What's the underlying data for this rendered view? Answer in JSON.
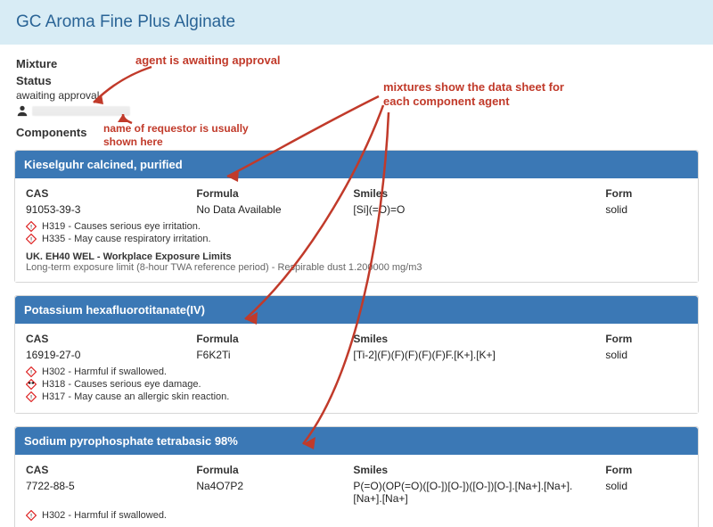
{
  "header": {
    "title": "GC Aroma Fine Plus Alginate"
  },
  "info": {
    "mixture_label": "Mixture",
    "status_label": "Status",
    "status_value": "awaiting approval"
  },
  "section": {
    "components_label": "Components"
  },
  "components": [
    {
      "name": "Kieselguhr calcined, purified",
      "cas_label": "CAS",
      "cas": "91053-39-3",
      "formula_label": "Formula",
      "formula": "No Data Available",
      "smiles_label": "Smiles",
      "smiles": "[Si](=O)=O",
      "form_label": "Form",
      "form": "solid",
      "hazards": [
        "H319 - Causes serious eye irritation.",
        "H335 - May cause respiratory irritation."
      ],
      "exposure_title": "UK. EH40 WEL - Workplace Exposure Limits",
      "exposure_text": "Long-term exposure limit (8-hour TWA reference period) - Respirable dust 1.200000 mg/m3"
    },
    {
      "name": "Potassium hexafluorotitanate(IV)",
      "cas_label": "CAS",
      "cas": "16919-27-0",
      "formula_label": "Formula",
      "formula": "F6K2Ti",
      "smiles_label": "Smiles",
      "smiles": "[Ti-2](F)(F)(F)(F)(F)F.[K+].[K+]",
      "form_label": "Form",
      "form": "solid",
      "hazards": [
        "H302 - Harmful if swallowed.",
        "H318 - Causes serious eye damage.",
        "H317 - May cause an allergic skin reaction."
      ]
    },
    {
      "name": "Sodium pyrophosphate tetrabasic 98%",
      "cas_label": "CAS",
      "cas": "7722-88-5",
      "formula_label": "Formula",
      "formula": "Na4O7P2",
      "smiles_label": "Smiles",
      "smiles": "P(=O)(OP(=O)([O-])[O-])([O-])[O-].[Na+].[Na+].[Na+].[Na+]",
      "form_label": "Form",
      "form": "solid",
      "hazards": [
        "H302 - Harmful if swallowed."
      ]
    }
  ],
  "annotations": {
    "status": "agent is awaiting approval",
    "requestor": "name of requestor is usually shown here",
    "mixtures": "mixtures show the data sheet for each component agent"
  }
}
